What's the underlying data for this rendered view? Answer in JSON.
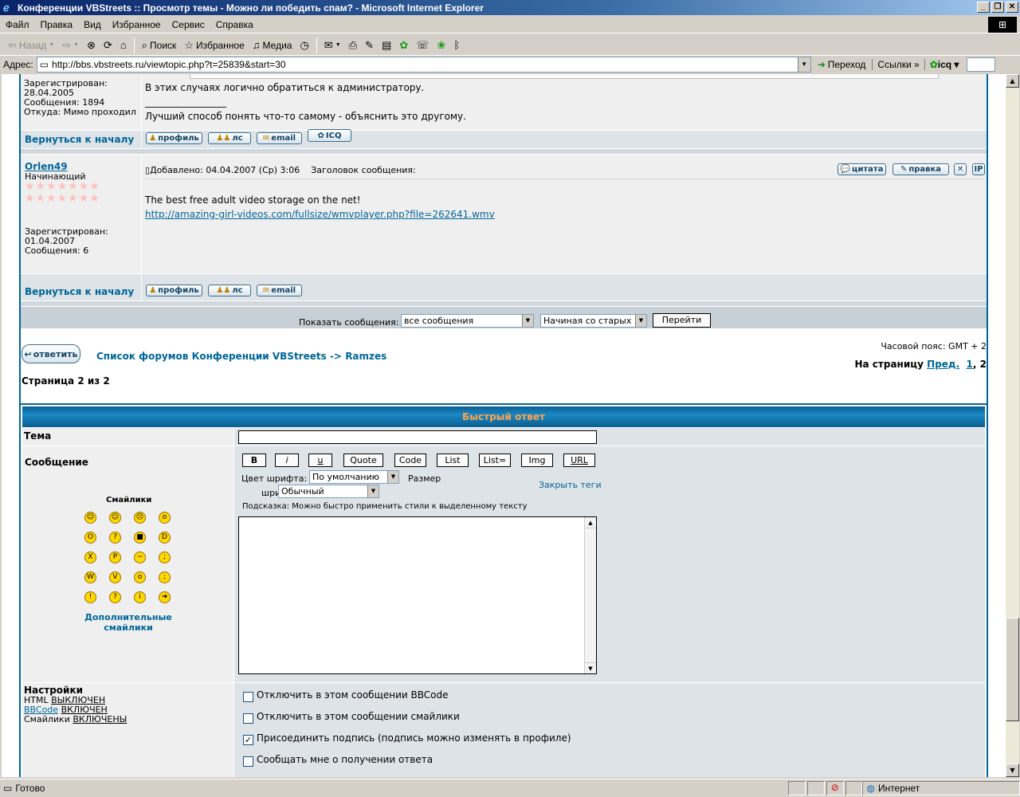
{
  "window": {
    "title": "Конференции VBStreets :: Просмотр темы - Можно ли победить спам? - Microsoft Internet Explorer"
  },
  "menu": [
    "Файл",
    "Правка",
    "Вид",
    "Избранное",
    "Сервис",
    "Справка"
  ],
  "toolbar": {
    "back": "Назад",
    "search": "Поиск",
    "favorites": "Избранное",
    "media": "Медиа"
  },
  "address": {
    "label": "Адрес:",
    "url": "http://bbs.vbstreets.ru/viewtopic.php?t=25839&start=30",
    "go": "Переход",
    "links": "Ссылки",
    "icq": "icq"
  },
  "post1": {
    "registered_label": "Зарегистрирован:",
    "registered_date": "28.04.2005",
    "messages": "Сообщения: 1894",
    "from": "Откуда: Мимо проходил",
    "text": "В этих случаях логично обратиться к администратору.",
    "signature_line": "_________________",
    "signature": "Лучший способ понять что-то самому - объяснить это другому.",
    "back_to_top": "Вернуться к началу",
    "buttons": {
      "profile": "профиль",
      "pm": "лс",
      "email": "email",
      "icq": "ICQ"
    }
  },
  "post2": {
    "author": "Orlen49",
    "rank": "Начинающий",
    "stars": "★★★★★★★",
    "registered_label": "Зарегистрирован:",
    "registered_date": "01.04.2007",
    "messages": "Сообщения: 6",
    "posted": "Добавлено: 04.04.2007 (Ср) 3:06",
    "subject_label": "Заголовок сообщения:",
    "text": "The best free adult video storage on the net!",
    "link": "http://amazing-girl-videos.com/fullsize/wmvplayer.php?file=262641.wmv",
    "back_to_top": "Вернуться к началу",
    "buttons": {
      "quote": "цитата",
      "edit": "правка",
      "delete": "✕",
      "ip": "IP",
      "profile": "профиль",
      "pm": "лс",
      "email": "email"
    }
  },
  "display": {
    "label": "Показать сообщения:",
    "filter": "все сообщения",
    "order": "Начиная со старых",
    "go": "Перейти"
  },
  "nav": {
    "reply": "ответить",
    "forum_index": "Список форумов Конференции VBStreets",
    "arrow": "->",
    "forum": "Ramzes",
    "timezone": "Часовой пояс: GMT + 2",
    "goto_page": "На страницу",
    "prev": "Пред.",
    "page1": "1",
    "page2": ", 2",
    "page_of": "Страница 2 из 2"
  },
  "quick_reply": {
    "title": "Быстрый ответ",
    "subject_label": "Тема",
    "message_label": "Сообщение",
    "smilies_label": "Смайлики",
    "more_smilies": "Дополнительные смайлики",
    "bbcode": [
      "B",
      "i",
      "u",
      "Quote",
      "Code",
      "List",
      "List=",
      "Img",
      "URL"
    ],
    "font_color_label": "Цвет шрифта:",
    "font_color_value": "По умолчанию",
    "font_size_label1": "Размер",
    "font_size_label2": "шрифта:",
    "font_size_value": "Обычный",
    "close_tags": "Закрыть теги",
    "hint": "Подсказка: Можно быстро применить стили к выделенному тексту",
    "settings_label": "Настройки",
    "html_label": "HTML",
    "html_state": "ВЫКЛЮЧЕН",
    "bbcode_label": "BBCode",
    "bbcode_state": "ВКЛЮЧЕН",
    "smilies_state_label": "Смайлики",
    "smilies_state": "ВКЛЮЧЕНЫ",
    "options": [
      {
        "label": "Отключить в этом сообщении BBCode",
        "checked": false
      },
      {
        "label": "Отключить в этом сообщении смайлики",
        "checked": false
      },
      {
        "label": "Присоединить подпись (подпись можно изменять в профиле)",
        "checked": true
      },
      {
        "label": "Сообщать мне о получении ответа",
        "checked": false
      }
    ]
  },
  "status": {
    "text": "Готово",
    "zone": "Интернет"
  }
}
